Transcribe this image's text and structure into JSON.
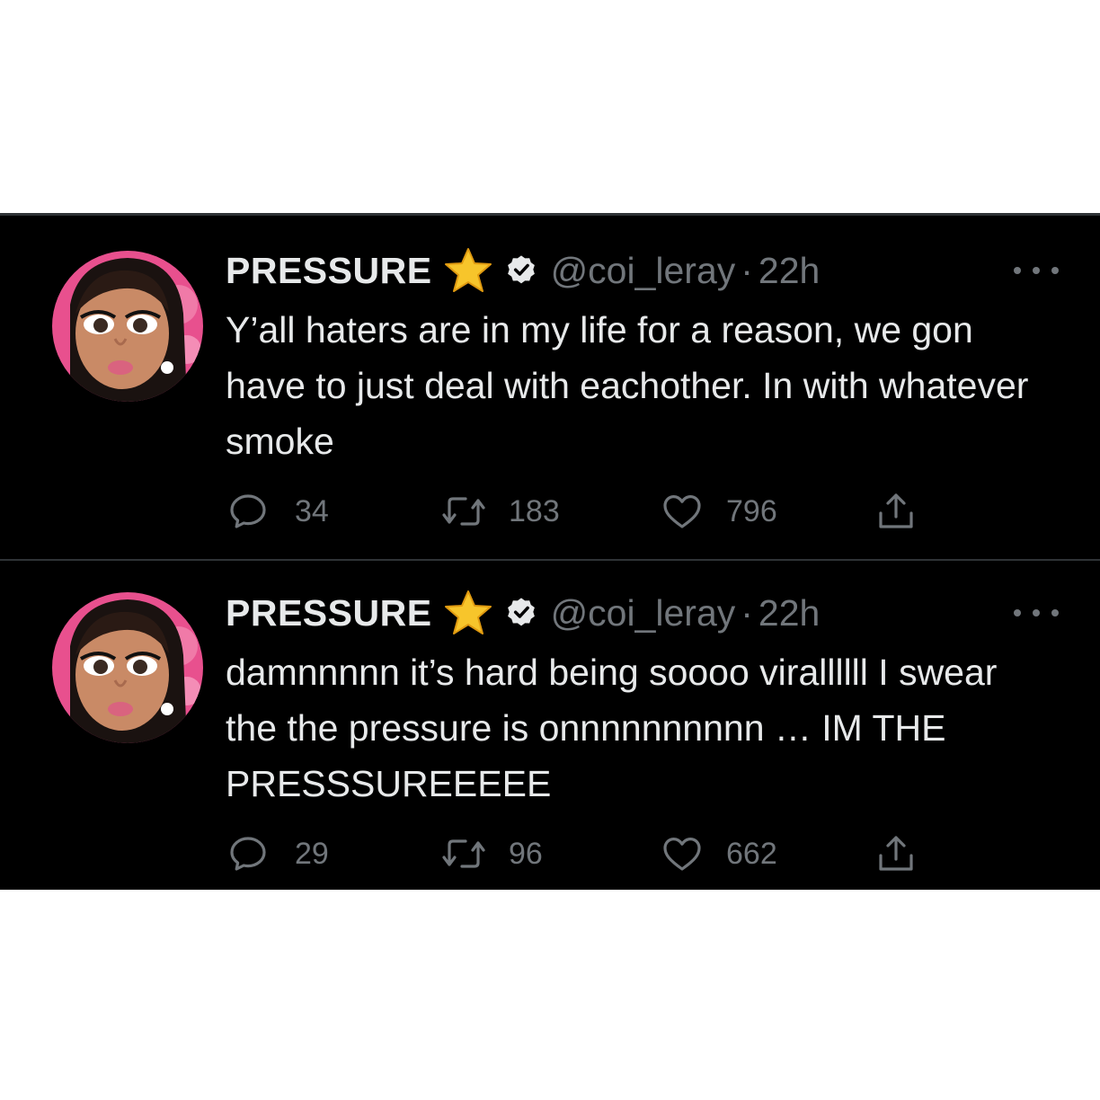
{
  "tweets": [
    {
      "display_name": "PRESSURE",
      "handle": "@coi_leray",
      "separator": "·",
      "time": "22h",
      "text": "Y’all haters are in my life for a reason, we gon have to just deal with eachother. In with whatever smoke",
      "replies": "34",
      "retweets": "183",
      "likes": "796"
    },
    {
      "display_name": "PRESSURE",
      "handle": "@coi_leray",
      "separator": "·",
      "time": "22h",
      "text": "damnnnnn it’s hard being soooo virallllll I swear the the pressure is onnnnnnnnnn … IM THE PRESSSUREEEEE",
      "replies": "29",
      "retweets": "96",
      "likes": "662"
    }
  ],
  "colors": {
    "background": "#000000",
    "text_primary": "#e7e9ea",
    "text_secondary": "#71767b",
    "divider": "#2f3336",
    "star": "#f7c52b",
    "avatar_pink": "#e8508e"
  },
  "icons": [
    "star-emoji",
    "verified-badge-icon",
    "more-icon",
    "reply-icon",
    "retweet-icon",
    "like-icon",
    "share-icon"
  ]
}
